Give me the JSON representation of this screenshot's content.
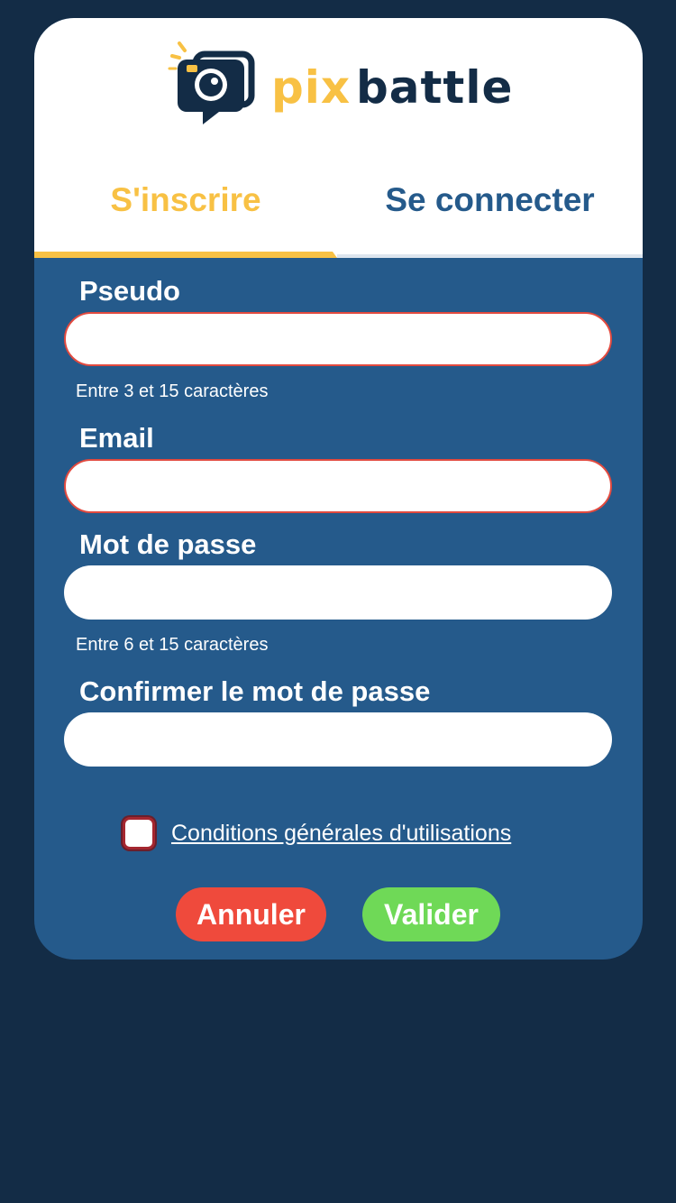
{
  "brand": {
    "name_part1": "pix",
    "name_part2": "battle",
    "colors": {
      "yellow": "#f8c144",
      "navy": "#132c46",
      "blue": "#255a8b",
      "red": "#ef4a3c",
      "green": "#6fd957"
    }
  },
  "tabs": {
    "signup": "S'inscrire",
    "login": "Se connecter",
    "active": "signup"
  },
  "form": {
    "pseudo": {
      "label": "Pseudo",
      "value": "",
      "hint": "Entre 3 et 15 caractères",
      "invalid": true
    },
    "email": {
      "label": "Email",
      "value": "",
      "invalid": true
    },
    "password": {
      "label": "Mot de passe",
      "value": "",
      "hint": "Entre 6 et 15 caractères"
    },
    "confirm_password": {
      "label": "Confirmer le mot de passe",
      "value": ""
    },
    "terms": {
      "label": "Conditions générales d'utilisations",
      "checked": false
    }
  },
  "buttons": {
    "cancel": "Annuler",
    "validate": "Valider"
  },
  "icons": {
    "logo": "camera-speech-bubble-icon",
    "checkbox": "checkbox-unchecked-icon"
  }
}
